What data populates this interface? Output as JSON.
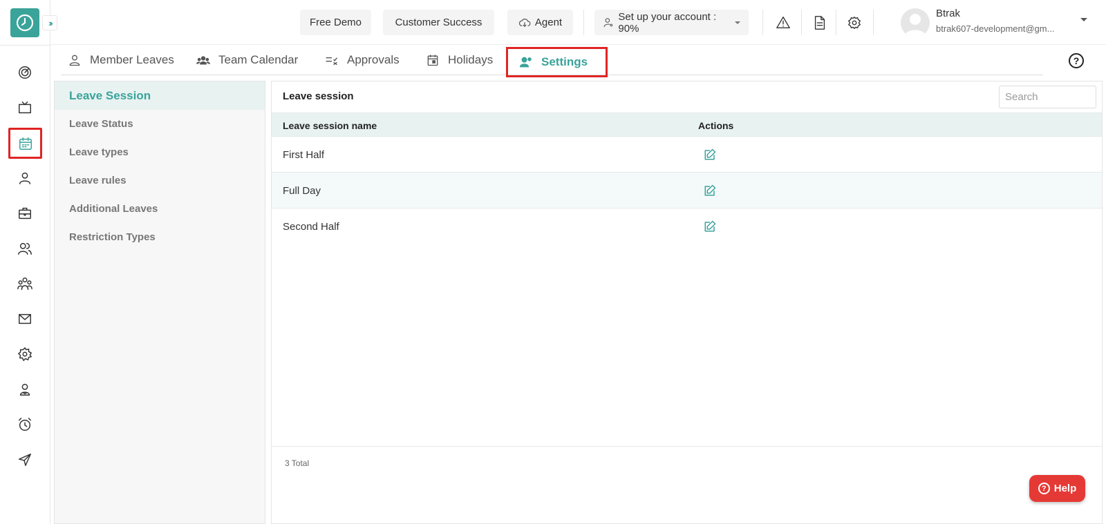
{
  "header": {
    "free_demo": "Free Demo",
    "customer_success": "Customer Success",
    "agent": "Agent",
    "setup": "Set up your account : 90%",
    "user_name": "Btrak",
    "user_email": "btrak607-development@gm..."
  },
  "tabs": [
    {
      "label": "Member Leaves"
    },
    {
      "label": "Team Calendar"
    },
    {
      "label": "Approvals"
    },
    {
      "label": "Holidays"
    },
    {
      "label": "Settings"
    }
  ],
  "side_menu": {
    "active": "Leave Session",
    "items": [
      "Leave Status",
      "Leave types",
      "Leave rules",
      "Additional Leaves",
      "Restriction Types"
    ]
  },
  "panel": {
    "title": "Leave session",
    "search_placeholder": "Search",
    "columns": [
      "Leave session name",
      "Actions"
    ],
    "rows": [
      {
        "name": "First Half"
      },
      {
        "name": "Full Day"
      },
      {
        "name": "Second Half"
      }
    ],
    "total": "3 Total"
  },
  "help_button": "Help",
  "colors": {
    "accent": "#3aa39a",
    "highlight": "#e02424",
    "help": "#e53935"
  }
}
